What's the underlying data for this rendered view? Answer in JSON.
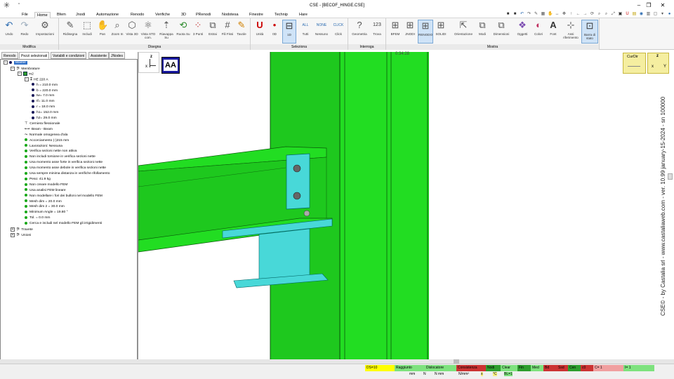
{
  "window": {
    "title": "CSE - [BECOF_HINGE.CSE]",
    "minimize": "–",
    "maximize": "❐",
    "close": "✕"
  },
  "menu": [
    "File",
    "Home",
    "Bfem",
    "Jnodi",
    "Automazione",
    "Renodo",
    "Verifiche",
    "3D",
    "PRenodi",
    "Nodotesa",
    "Finestre",
    "Technip",
    "Hare"
  ],
  "menu_active": "Home",
  "ribbon": {
    "groups": [
      {
        "label": "Modifica",
        "buttons": [
          {
            "label": "Undo",
            "icon": "undo-icon"
          },
          {
            "label": "Redo",
            "icon": "redo-icon"
          },
          {
            "label": "Impostazioni",
            "icon": "settings-icon"
          }
        ]
      },
      {
        "label": "Disegna",
        "buttons": [
          {
            "label": "Ridisegna",
            "icon": "pencil-icon"
          },
          {
            "label": "Includi",
            "icon": "include-icon"
          },
          {
            "label": "Pan",
            "icon": "hand-icon"
          },
          {
            "label": "Zoom In",
            "icon": "zoom-icon"
          },
          {
            "label": "Vista 3D",
            "icon": "cube-icon"
          },
          {
            "label": "Vista STD com.",
            "icon": "view-icon"
          },
          {
            "label": "Riavappa Su",
            "icon": "arrow-up-icon"
          },
          {
            "label": "Ruota Su",
            "icon": "rotate-icon"
          },
          {
            "label": "3 Punti",
            "icon": "points-icon"
          },
          {
            "label": "Estrai",
            "icon": "extract-icon"
          },
          {
            "label": "Fili Fissi",
            "icon": "grid-icon"
          },
          {
            "label": "Tavole",
            "icon": "pencil-icon"
          }
        ]
      },
      {
        "label": "Seleziona",
        "buttons": [
          {
            "label": "Unità",
            "icon": "unit-icon"
          },
          {
            "label": "0D",
            "icon": "dot-icon"
          },
          {
            "label": "1D",
            "icon": "line-icon",
            "selected": true
          },
          {
            "label": "Tutti",
            "icon": "all-icon",
            "top": "ALL"
          },
          {
            "label": "Nessuno",
            "icon": "none-icon",
            "top": "NONE"
          },
          {
            "label": "Click",
            "icon": "click-icon",
            "top": "CLICK"
          }
        ]
      },
      {
        "label": "Interroga",
        "buttons": [
          {
            "label": "Geometria",
            "icon": "question-icon"
          },
          {
            "label": "Trova",
            "icon": "find-icon",
            "top": "123"
          }
        ]
      },
      {
        "label": "Mostra",
        "buttons": [
          {
            "label": "BFEM",
            "icon": "bfem-icon"
          },
          {
            "label": "JNODI",
            "icon": "jnodi-icon"
          },
          {
            "label": "RENODO",
            "icon": "renodo-icon",
            "selected": true
          },
          {
            "label": "SOLIDI",
            "icon": "solidi-icon"
          },
          {
            "label": "Orientazione",
            "icon": "orient-icon"
          },
          {
            "label": "Modi",
            "icon": "modi-icon"
          },
          {
            "label": "Dimensioni",
            "icon": "dims-icon"
          },
          {
            "label": "Oggetti",
            "icon": "objects-icon"
          },
          {
            "label": "Colori",
            "icon": "colors-icon"
          },
          {
            "label": "Font",
            "icon": "font-icon",
            "top": "A"
          },
          {
            "label": "Assi riferimento",
            "icon": "axes-icon"
          },
          {
            "label": "Barra di stato",
            "icon": "statusbar-icon",
            "selected": true
          }
        ]
      }
    ]
  },
  "panel_tabs": [
    "Renodo",
    "Pezzi selezionati",
    "Variabili e condizioni",
    "Assistente",
    "JNodes"
  ],
  "panel_tab_active": "Pezzi selezionati",
  "tree": [
    {
      "text": "Master",
      "indent": 0,
      "kind": "root",
      "selected": true
    },
    {
      "text": "Membrature",
      "indent": 1,
      "kind": "folder"
    },
    {
      "text": "m2",
      "indent": 2,
      "kind": "member"
    },
    {
      "text": "HE 220 A",
      "indent": 3,
      "kind": "section"
    },
    {
      "text": "h = 210.0 mm",
      "indent": 4,
      "kind": "prop"
    },
    {
      "text": "b = 220.0 mm",
      "indent": 4,
      "kind": "prop"
    },
    {
      "text": "tw=   7.0 mm",
      "indent": 4,
      "kind": "prop"
    },
    {
      "text": "tf=  11.0 mm",
      "indent": 4,
      "kind": "prop"
    },
    {
      "text": "r =  18.0 mm",
      "indent": 4,
      "kind": "prop"
    },
    {
      "text": "h1= 152.0 mm",
      "indent": 4,
      "kind": "prop"
    },
    {
      "text": "h2=  29.0 mm",
      "indent": 4,
      "kind": "prop"
    },
    {
      "text": "Cerniera flessionale",
      "indent": 3,
      "kind": "hinge"
    },
    {
      "text": "Beam - Beam",
      "indent": 3,
      "kind": "beam"
    },
    {
      "text": "Normale omogenea d'ala",
      "indent": 3,
      "kind": "normal"
    },
    {
      "text": "Accorciamento (-)215  mm",
      "indent": 3,
      "kind": "opt"
    },
    {
      "text": "Lavorazioni: Nessuna",
      "indent": 3,
      "kind": "opt"
    },
    {
      "text": "Verifica sezioni nette non attiva",
      "indent": 3,
      "kind": "opt"
    },
    {
      "text": "Non includi torsione in verifica sezioni nette",
      "indent": 3,
      "kind": "opt"
    },
    {
      "text": "Usa momento asse forte in verifica sezioni nette",
      "indent": 3,
      "kind": "opt"
    },
    {
      "text": "Usa momento asse debole in verifica sezioni nette",
      "indent": 3,
      "kind": "opt"
    },
    {
      "text": "Usa sempre minima distanza in verifiche rifollamento",
      "indent": 3,
      "kind": "opt"
    },
    {
      "text": "Peso:      41.9 kg",
      "indent": 3,
      "kind": "opt"
    },
    {
      "text": "Non creare modello FEM",
      "indent": 3,
      "kind": "opt"
    },
    {
      "text": "Usa analisi FEM lineare",
      "indent": 3,
      "kind": "opt"
    },
    {
      "text": "Non modellare i fori dei bulloni nel modello FEM",
      "indent": 3,
      "kind": "opt"
    },
    {
      "text": "Mesh dim =  20.0 mm",
      "indent": 3,
      "kind": "opt"
    },
    {
      "text": "Mesh dim 2 =  30.0 mm",
      "indent": 3,
      "kind": "opt"
    },
    {
      "text": "Minimum Angle = 19.80 °",
      "indent": 3,
      "kind": "opt"
    },
    {
      "text": "Tol. =   0.0 mm",
      "indent": 3,
      "kind": "opt"
    },
    {
      "text": "Cerca e includi nel modello FEM gli irrigidimenti",
      "indent": 3,
      "kind": "opt"
    },
    {
      "text": "Travete",
      "indent": 1,
      "kind": "folder2"
    },
    {
      "text": "Unioni",
      "indent": 1,
      "kind": "folder2"
    }
  ],
  "viewport": {
    "label": "AA",
    "axis_z": "z",
    "axis_x": "x",
    "axis_y": "Y",
    "clock": "0:34:28"
  },
  "corner_widgets": {
    "curdir": "CurDir",
    "z": "z",
    "x": "x",
    "y": "Y"
  },
  "credits": "CSE© - by Castalia srl - www.castaliaweb.com - ver. 10.99 january-15-2024 - sn 100000",
  "status": {
    "cells": [
      {
        "text": "DS=10",
        "color": "#ffff00"
      },
      {
        "text": "Raggiunto",
        "color": "#7ee27e"
      },
      {
        "text": "Dislocatore",
        "color": "#7ee27e"
      },
      {
        "text": "Consistenza",
        "color": "#cc3333"
      },
      {
        "text": "Nodi",
        "color": "#2e9e2e"
      },
      {
        "text": "Clear",
        "color": "#7ee27e"
      },
      {
        "text": "Fin",
        "color": "#2e9e2e"
      },
      {
        "text": "Med",
        "color": "#7ee27e"
      },
      {
        "text": "Bd",
        "color": "#cc3333"
      },
      {
        "text": "Ssd",
        "color": "#cc3333"
      },
      {
        "text": "Cen",
        "color": "#2e9e2e"
      },
      {
        "text": "c0",
        "color": "#cc3333"
      },
      {
        "text": "C= 1",
        "color": "#f0a0a0"
      },
      {
        "text": "I= 1",
        "color": "#7ee27e"
      }
    ],
    "units": [
      "mm",
      "N",
      "N mm",
      "N/mm²",
      "s",
      "°C",
      "BL=1"
    ]
  }
}
